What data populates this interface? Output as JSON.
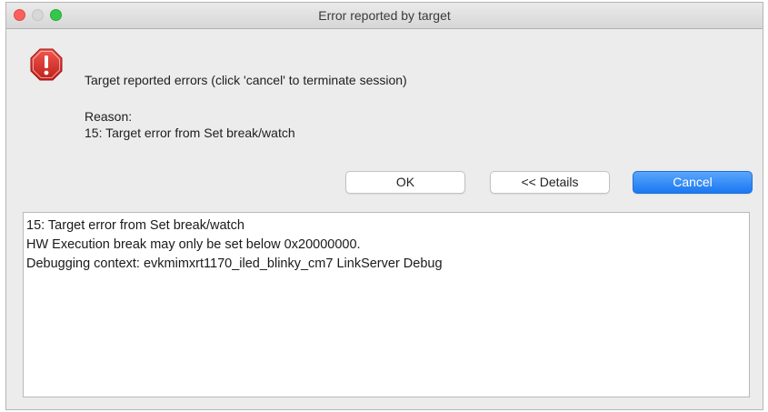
{
  "window": {
    "title": "Error reported by target"
  },
  "icon": "alert-stop-icon",
  "message": {
    "headline": "Target reported errors (click 'cancel' to terminate session)",
    "reason_label": "Reason:",
    "reason_text": "15: Target error from Set break/watch"
  },
  "buttons": {
    "ok": "OK",
    "details": "<< Details",
    "cancel": "Cancel"
  },
  "details": {
    "lines": [
      "15: Target error from Set break/watch",
      "HW Execution break may only be set below 0x20000000.",
      "Debugging context: evkmimxrt1170_iled_blinky_cm7 LinkServer Debug"
    ]
  },
  "colors": {
    "accent": "#1a78f2",
    "alert_red": "#d9312b",
    "close": "#fc605c",
    "zoom": "#34c84a"
  }
}
